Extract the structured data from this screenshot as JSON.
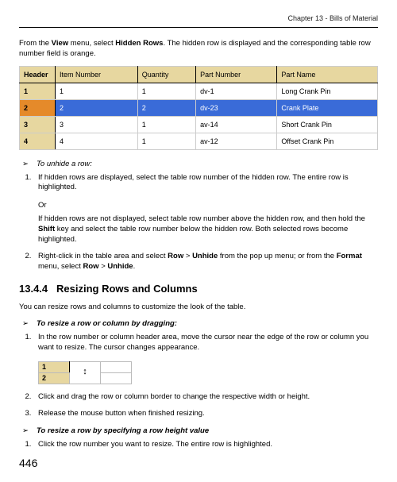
{
  "chapter": "Chapter 13 - Bills of Material",
  "intro": {
    "pre": "From the ",
    "menu1_b": "View",
    "mid1": " menu, select ",
    "menu2_b": "Hidden Rows",
    "post": ". The hidden row is displayed and the corresponding table row number field is orange."
  },
  "table": {
    "headers": {
      "h0": "Header",
      "h1": "Item Number",
      "h2": "Quantity",
      "h3": "Part Number",
      "h4": "Part Name"
    },
    "rows": [
      {
        "rownum": "1",
        "item": "1",
        "qty": "1",
        "pn": "dv-1",
        "name": "Long Crank Pin",
        "selected": false
      },
      {
        "rownum": "2",
        "item": "2",
        "qty": "2",
        "pn": "dv-23",
        "name": "Crank Plate",
        "selected": true
      },
      {
        "rownum": "3",
        "item": "3",
        "qty": "1",
        "pn": "av-14",
        "name": "Short Crank Pin",
        "selected": false
      },
      {
        "rownum": "4",
        "item": "4",
        "qty": "1",
        "pn": "av-12",
        "name": "Offset Crank Pin",
        "selected": false
      }
    ]
  },
  "unhide_title": "To unhide a row:",
  "unhide_li1": "If hidden rows are displayed, select the table row number of the hidden row. The entire row is highlighted.",
  "or_text": "Or",
  "unhide_or_para": {
    "pre": "If hidden rows are not displayed, select table row number above the hidden row, and then hold the ",
    "key_b": "Shift",
    "post": " key and select the table row number below the hidden row. Both selected rows become highlighted."
  },
  "unhide_li2": {
    "pre": "Right-click in the table area and select ",
    "b1": "Row",
    "sep1": " > ",
    "b2": "Unhide",
    "mid": " from the pop up menu; or from the ",
    "b3": "Format",
    "mid2": " menu, select ",
    "b4": "Row",
    "sep2": " > ",
    "b5": "Unhide",
    "post": "."
  },
  "section_num": "13.4.4",
  "section_title": "Resizing Rows and Columns",
  "resize_intro": "You can resize rows and columns to customize the look of the table.",
  "resize_drag_title": "To resize a row or column by dragging:",
  "resize_li1": "In the row number or column header area, move the cursor near the edge of the row or column you want to resize. The cursor changes appearance.",
  "mini_rows": {
    "r1": "1",
    "r2": "2"
  },
  "resize_li2": "Click and drag the row or column border to change the respective width or height.",
  "resize_li3": "Release the mouse button when finished resizing.",
  "resize_value_title": "To resize a row by specifying a row height value",
  "resize_val_li1": "Click the row number you want to resize. The entire row is highlighted.",
  "page_number": "446",
  "glyphs": {
    "arrow": "➢",
    "resize_cursor": "↕"
  }
}
